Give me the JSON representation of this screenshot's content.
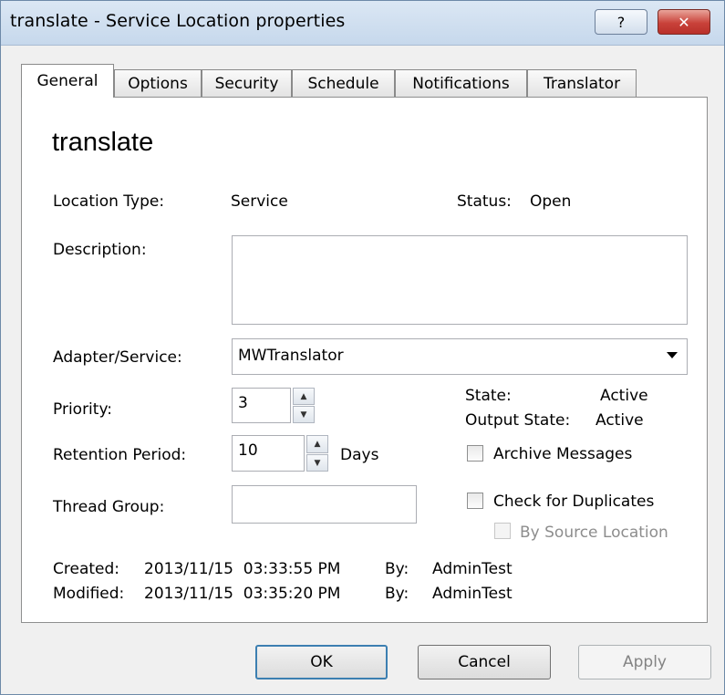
{
  "window": {
    "title": "translate - Service Location properties",
    "help_glyph": "?",
    "close_glyph": "✕"
  },
  "tabs": [
    {
      "label": "General"
    },
    {
      "label": "Options"
    },
    {
      "label": "Security"
    },
    {
      "label": "Schedule"
    },
    {
      "label": "Notifications"
    },
    {
      "label": "Translator"
    }
  ],
  "general": {
    "name": "translate",
    "location_type_label": "Location Type:",
    "location_type_value": "Service",
    "status_label": "Status:",
    "status_value": "Open",
    "description_label": "Description:",
    "description_value": "",
    "adapter_label": "Adapter/Service:",
    "adapter_value": "MWTranslator",
    "priority_label": "Priority:",
    "priority_value": "3",
    "retention_label": "Retention Period:",
    "retention_value": "10",
    "retention_unit": "Days",
    "thread_group_label": "Thread Group:",
    "thread_group_value": "",
    "state_label": "State:",
    "state_value": "Active",
    "output_state_label": "Output State:",
    "output_state_value": "Active",
    "archive_label": "Archive Messages",
    "duplicates_label": "Check for Duplicates",
    "by_source_label": "By Source Location",
    "created_label": "Created:",
    "created_value": "2013/11/15  03:33:55 PM",
    "created_by_label": "By:",
    "created_by_value": "AdminTest",
    "modified_label": "Modified:",
    "modified_value": "2013/11/15  03:35:20 PM",
    "modified_by_label": "By:",
    "modified_by_value": "AdminTest"
  },
  "buttons": {
    "ok": "OK",
    "cancel": "Cancel",
    "apply": "Apply"
  },
  "icons": {
    "dropdown": "chevron-down-icon",
    "spin_up": "spin-up-icon",
    "spin_down": "spin-down-icon"
  },
  "colors": {
    "close_button": "#c9423a",
    "default_button_border": "#3c7fb1",
    "title_bar": "#c6d8ec"
  }
}
